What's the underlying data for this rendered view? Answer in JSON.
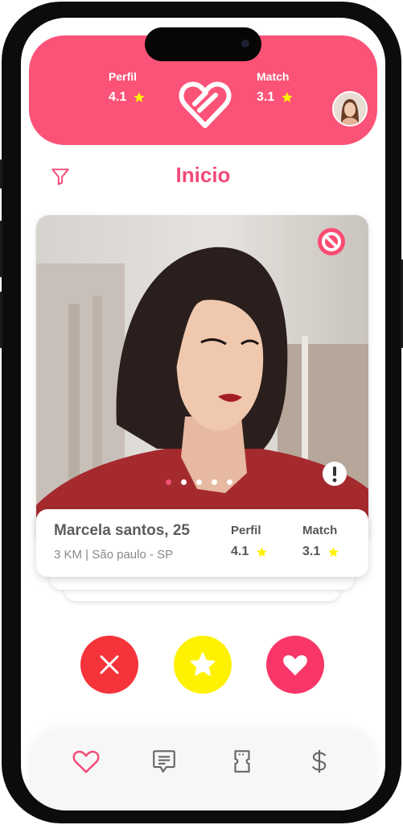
{
  "header": {
    "profile_label": "Perfil",
    "profile_rating": "4.1",
    "match_label": "Match",
    "match_rating": "3.1",
    "brand_color": "#fb5378"
  },
  "page": {
    "title": "Inicio"
  },
  "card": {
    "photo_indicator_count": 5,
    "photo_indicator_active": 1,
    "name": "Marcela santos, 25",
    "location": "3 KM | São paulo - SP",
    "profile_label": "Perfil",
    "profile_rating": "4.1",
    "match_label": "Match",
    "match_rating": "3.1"
  },
  "actions": {
    "dislike_color": "#f5333a",
    "superlike_color": "#fff200",
    "like_color": "#f93668"
  },
  "nav": {
    "items": [
      "heart-icon",
      "chat-icon",
      "ticket-icon",
      "dollar-icon"
    ],
    "active": "heart-icon"
  },
  "colors": {
    "accent": "#f24a78",
    "star": "#fff200"
  }
}
